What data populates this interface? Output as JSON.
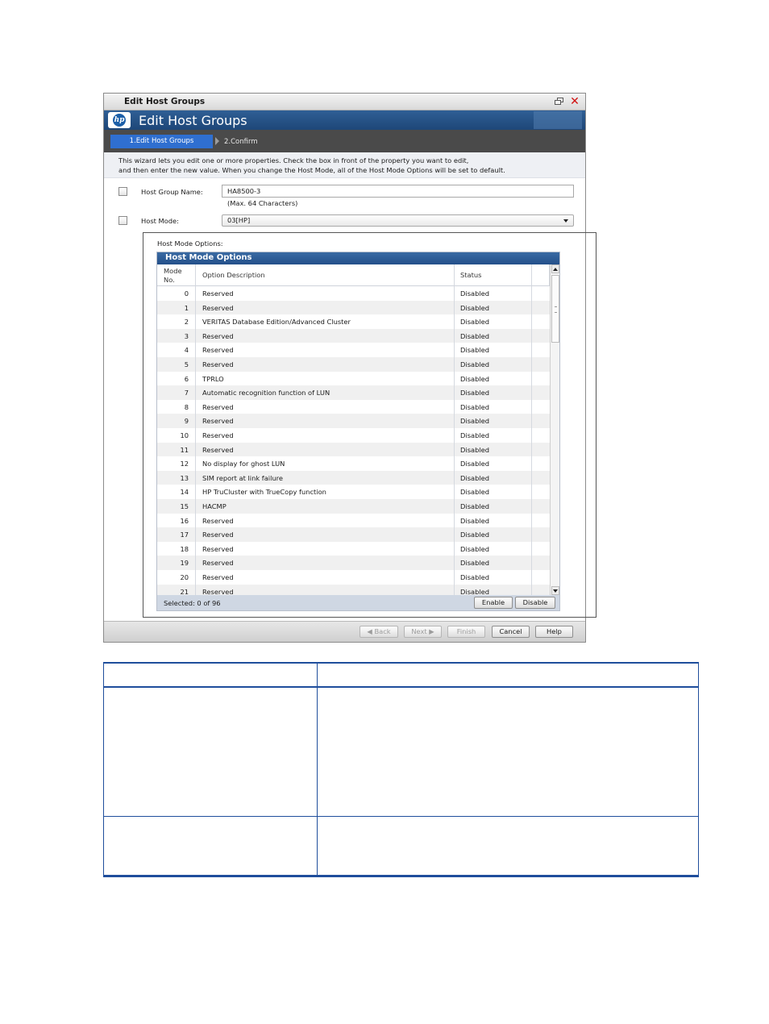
{
  "window": {
    "title": "Edit Host Groups",
    "banner_title": "Edit Host Groups",
    "logo_text": "hp"
  },
  "steps": [
    {
      "label": "1.Edit Host Groups",
      "active": true
    },
    {
      "label": "2.Confirm",
      "active": false
    }
  ],
  "intro": {
    "line1": "This wizard lets you edit one or more properties. Check the  box in front of the property you want to edit,",
    "line2": "and then enter the new value. When you change the Host Mode, all of the Host Mode Options will be set to default."
  },
  "form": {
    "host_group_name_label": "Host Group Name:",
    "host_group_name_value": "HA8500-3",
    "host_group_name_hint": "(Max. 64 Characters)",
    "host_mode_label": "Host Mode:",
    "host_mode_value": "03[HP]"
  },
  "host_mode_options": {
    "panel_label": "Host Mode Options:",
    "grid_title": "Host Mode Options",
    "columns": {
      "mode_no": "Mode\nNo.",
      "description": "Option Description",
      "status": "Status"
    },
    "rows": [
      {
        "no": "0",
        "desc": "Reserved",
        "status": "Disabled"
      },
      {
        "no": "1",
        "desc": "Reserved",
        "status": "Disabled"
      },
      {
        "no": "2",
        "desc": "VERITAS Database Edition/Advanced Cluster",
        "status": "Disabled"
      },
      {
        "no": "3",
        "desc": "Reserved",
        "status": "Disabled"
      },
      {
        "no": "4",
        "desc": "Reserved",
        "status": "Disabled"
      },
      {
        "no": "5",
        "desc": "Reserved",
        "status": "Disabled"
      },
      {
        "no": "6",
        "desc": "TPRLO",
        "status": "Disabled"
      },
      {
        "no": "7",
        "desc": "Automatic recognition function of LUN",
        "status": "Disabled"
      },
      {
        "no": "8",
        "desc": "Reserved",
        "status": "Disabled"
      },
      {
        "no": "9",
        "desc": "Reserved",
        "status": "Disabled"
      },
      {
        "no": "10",
        "desc": "Reserved",
        "status": "Disabled"
      },
      {
        "no": "11",
        "desc": "Reserved",
        "status": "Disabled"
      },
      {
        "no": "12",
        "desc": "No display for ghost LUN",
        "status": "Disabled"
      },
      {
        "no": "13",
        "desc": "SIM report at link failure",
        "status": "Disabled"
      },
      {
        "no": "14",
        "desc": "HP TruCluster with TrueCopy function",
        "status": "Disabled"
      },
      {
        "no": "15",
        "desc": "HACMP",
        "status": "Disabled"
      },
      {
        "no": "16",
        "desc": "Reserved",
        "status": "Disabled"
      },
      {
        "no": "17",
        "desc": "Reserved",
        "status": "Disabled"
      },
      {
        "no": "18",
        "desc": "Reserved",
        "status": "Disabled"
      },
      {
        "no": "19",
        "desc": "Reserved",
        "status": "Disabled"
      },
      {
        "no": "20",
        "desc": "Reserved",
        "status": "Disabled"
      },
      {
        "no": "21",
        "desc": "Reserved",
        "status": "Disabled"
      }
    ],
    "selected_text": "Selected:  0    of  96",
    "enable_label": "Enable",
    "disable_label": "Disable"
  },
  "footer_buttons": {
    "back": "Back",
    "next": "Next",
    "finish": "Finish",
    "cancel": "Cancel",
    "help": "Help"
  },
  "colors": {
    "banner": "#1e4778",
    "active_step": "#2f6fd0",
    "grid_header": "#24508a",
    "table_rule": "#1f4e9c"
  }
}
